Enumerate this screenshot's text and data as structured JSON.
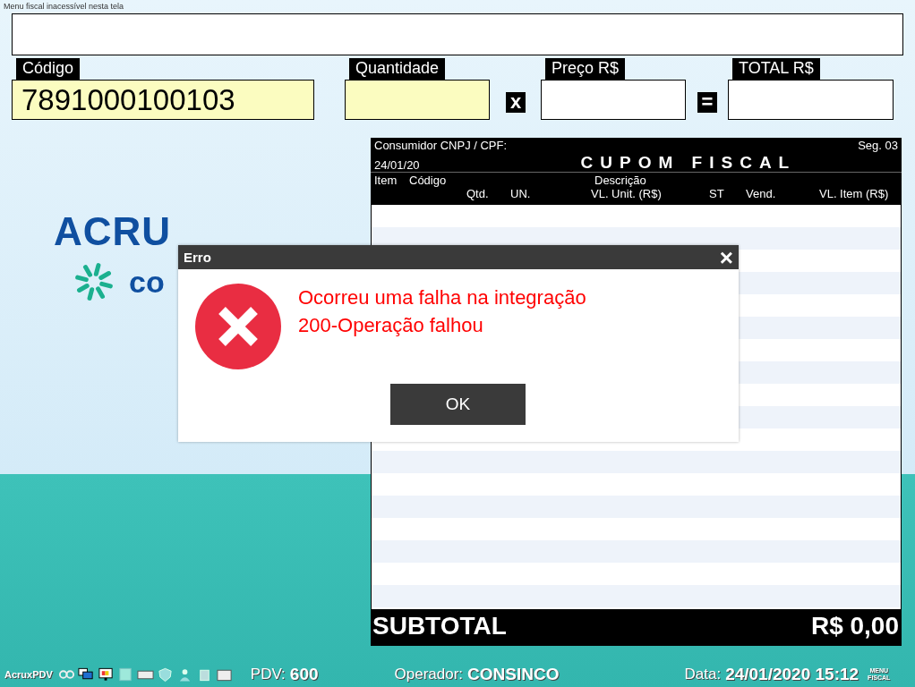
{
  "hint": "Menu fiscal inacessível nesta tela",
  "entry": [
    {
      "kind": "field",
      "label": "Código",
      "value": "7891000100103",
      "highlighted": true
    },
    {
      "kind": "field",
      "label": "Quantidade",
      "highlighted": true
    },
    {
      "kind": "operator",
      "symbol": "x"
    },
    {
      "kind": "field",
      "label": "Preço R$",
      "highlighted": false
    },
    {
      "kind": "operator",
      "symbol": "="
    },
    {
      "kind": "field",
      "label": "TOTAL R$",
      "highlighted": false
    }
  ],
  "logo": {
    "brand": "ACRU",
    "partner": "co"
  },
  "receipt": {
    "customer_label": "Consumidor CNPJ / CPF:",
    "sequence": "Seg. 03",
    "date": "24/01/20",
    "title": "CUPOM FISCAL",
    "columns_top": [
      "Item",
      "Código",
      "Descrição"
    ],
    "columns_bottom": [
      "Qtd.",
      "UN.",
      "VL. Unit. (R$)",
      "ST",
      "Vend.",
      "VL. Item (R$)"
    ],
    "subtotal_label": "SUBTOTAL",
    "subtotal_value": "R$ 0,00"
  },
  "dialog": {
    "title": "Erro",
    "close": "×",
    "message": [
      "Ocorreu uma falha na integração",
      "200-Operação falhou"
    ],
    "button": "OK"
  },
  "status_bar": {
    "app": "AcruxPDV",
    "pdv_label": "PDV:",
    "pdv": "600",
    "operator_label": "Operador:",
    "operator": "CONSINCO",
    "date_label": "Data:",
    "date": "24/01/2020 15:12",
    "menu": [
      "MENU",
      "FISCAL"
    ]
  }
}
